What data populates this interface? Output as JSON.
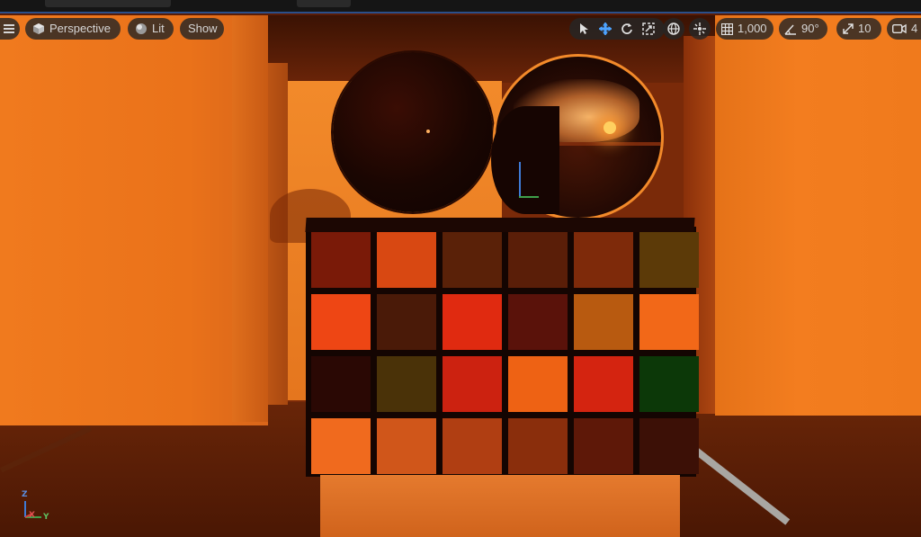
{
  "viewport_toolbar": {
    "menu_icon": "hamburger-icon",
    "view_mode": {
      "icon": "cube-icon",
      "label": "Perspective"
    },
    "lighting": {
      "icon": "sphere-icon",
      "label": "Lit"
    },
    "show": {
      "label": "Show"
    },
    "transform_tools": [
      "select-icon",
      "move-icon",
      "rotate-icon",
      "scale-icon"
    ],
    "world_space_icon": "globe-icon",
    "surface_snapping_icon": "snap-surface-icon",
    "grid_snap": {
      "icon": "grid-icon",
      "value": "1,000"
    },
    "rotation_snap": {
      "icon": "angle-icon",
      "value": "90°"
    },
    "scale_snap": {
      "icon": "scale-snap-icon",
      "value": "10"
    },
    "camera_speed": {
      "icon": "camera-icon",
      "value": "4"
    }
  },
  "axis_indicator": {
    "z": "Z",
    "x": "X",
    "y": "Y"
  },
  "colors": {
    "accent": "#4da3ff",
    "toolbar_bg": "#262626",
    "chips": [
      [
        "#7a1a08",
        "#d84812",
        "#5a2108",
        "#5a1e08",
        "#7e2a0a",
        "#5c3a08"
      ],
      [
        "#ee4614",
        "#4a1a08",
        "#e02a10",
        "#5a120a",
        "#b85a10",
        "#f26818"
      ],
      [
        "#2a0804",
        "#4a3208",
        "#cc2210",
        "#ee6214",
        "#d42410",
        "#0c3808"
      ],
      [
        "#f06a1e",
        "#d0561a",
        "#b03e12",
        "#8a2e0c",
        "#5e1808",
        "#3c1006"
      ]
    ]
  }
}
